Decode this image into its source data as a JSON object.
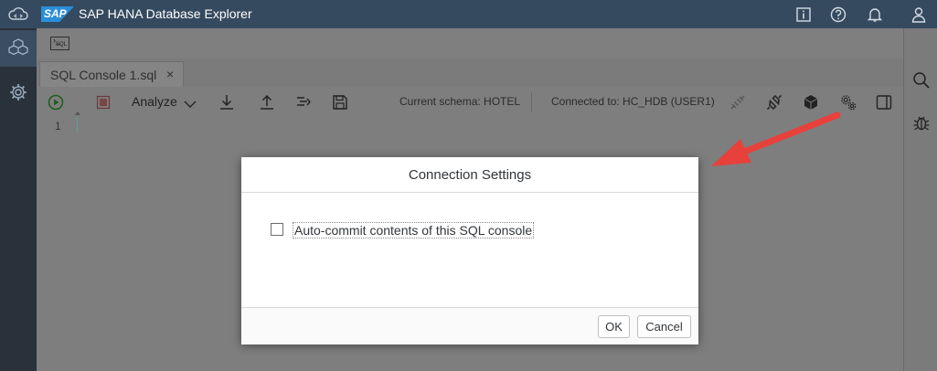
{
  "shell": {
    "logo_text": "SAP",
    "title": "SAP HANA Database Explorer",
    "brand_color": "#354a5f",
    "icons": [
      "cloud-icon",
      "info-icon",
      "help-icon",
      "notifications-icon",
      "user-icon"
    ]
  },
  "sidebar": {
    "items": [
      {
        "icon": "database-cubes-icon",
        "active": true
      },
      {
        "icon": "settings-gear-icon",
        "active": false
      }
    ]
  },
  "topbar": {
    "sql_button_label": "SQL"
  },
  "tabs": [
    {
      "label": "SQL Console 1.sql",
      "close": "×"
    }
  ],
  "toolbar": {
    "analyze_label": "Analyze",
    "current_schema": "Current schema: HOTEL",
    "connected_to": "Connected to: HC_HDB (USER1)",
    "icons": [
      "run-icon",
      "stop-icon",
      "download-icon",
      "upload-icon",
      "format-icon",
      "save-icon",
      "disconnect-icon",
      "connection-icon",
      "cube-icon",
      "connection-settings-icon",
      "panel-icon"
    ]
  },
  "editor": {
    "line_numbers": [
      "1"
    ]
  },
  "right_panel": {
    "icons": [
      "search-icon",
      "debug-icon"
    ]
  },
  "dialog": {
    "title": "Connection Settings",
    "checkbox_label": "Auto-commit contents of this SQL console",
    "checkbox_checked": false,
    "ok_label": "OK",
    "cancel_label": "Cancel"
  },
  "annotation": {
    "arrow_color": "#e8413c"
  }
}
